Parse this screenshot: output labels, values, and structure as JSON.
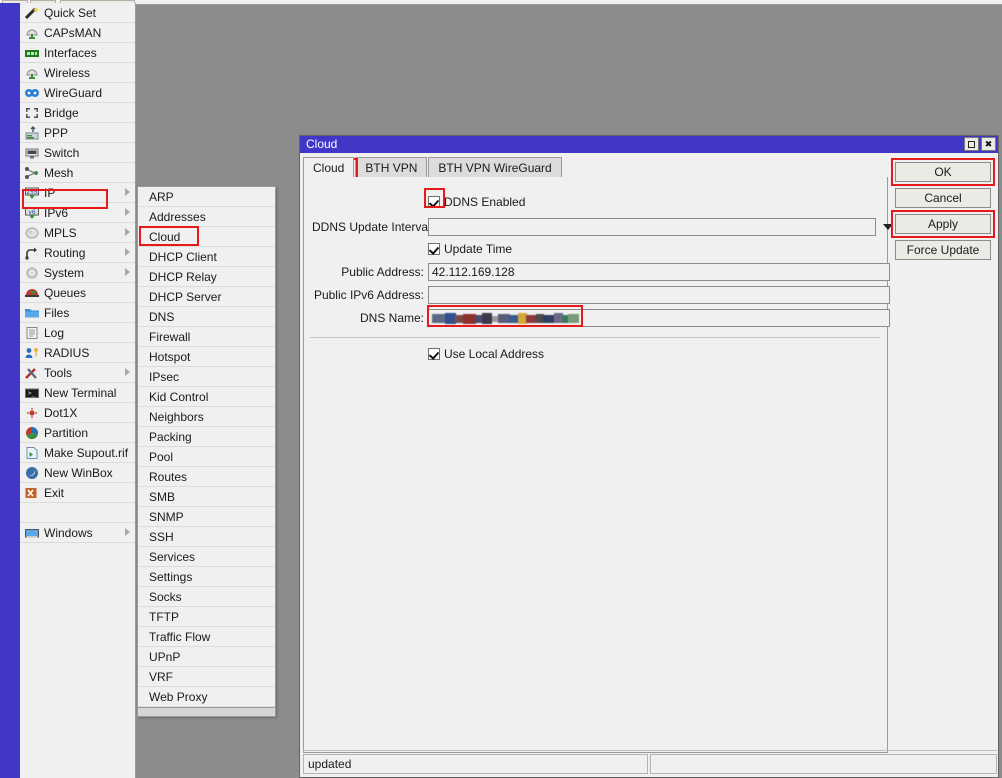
{
  "window": {
    "desktop_bg": "#8c8c8c",
    "accent": "#4036c8",
    "highlight_color": "#e51b1b"
  },
  "sidebar": {
    "items": [
      {
        "label": "Quick Set",
        "icon": "wand-icon",
        "submenu": false
      },
      {
        "label": "CAPsMAN",
        "icon": "antenna-icon",
        "submenu": false
      },
      {
        "label": "Interfaces",
        "icon": "network-card-icon",
        "submenu": false
      },
      {
        "label": "Wireless",
        "icon": "antenna-icon",
        "submenu": false
      },
      {
        "label": "WireGuard",
        "icon": "wireguard-icon",
        "submenu": false
      },
      {
        "label": "Bridge",
        "icon": "bridge-icon",
        "submenu": false
      },
      {
        "label": "PPP",
        "icon": "ppp-icon",
        "submenu": false
      },
      {
        "label": "Switch",
        "icon": "switch-icon",
        "submenu": false
      },
      {
        "label": "Mesh",
        "icon": "mesh-icon",
        "submenu": false
      },
      {
        "label": "IP",
        "icon": "ip-255-icon",
        "submenu": true
      },
      {
        "label": "IPv6",
        "icon": "ipv6-icon",
        "submenu": true
      },
      {
        "label": "MPLS",
        "icon": "mpls-icon",
        "submenu": true
      },
      {
        "label": "Routing",
        "icon": "routing-icon",
        "submenu": true
      },
      {
        "label": "System",
        "icon": "gear-icon",
        "submenu": true
      },
      {
        "label": "Queues",
        "icon": "queues-icon",
        "submenu": false
      },
      {
        "label": "Files",
        "icon": "folder-icon",
        "submenu": false
      },
      {
        "label": "Log",
        "icon": "log-icon",
        "submenu": false
      },
      {
        "label": "RADIUS",
        "icon": "radius-icon",
        "submenu": false
      },
      {
        "label": "Tools",
        "icon": "tools-icon",
        "submenu": true
      },
      {
        "label": "New Terminal",
        "icon": "terminal-icon",
        "submenu": false
      },
      {
        "label": "Dot1X",
        "icon": "dot1x-icon",
        "submenu": false
      },
      {
        "label": "Partition",
        "icon": "partition-icon",
        "submenu": false
      },
      {
        "label": "Make Supout.rif",
        "icon": "supout-icon",
        "submenu": false
      },
      {
        "label": "New WinBox",
        "icon": "winbox-icon",
        "submenu": false
      },
      {
        "label": "Exit",
        "icon": "exit-icon",
        "submenu": false
      },
      {
        "label": "",
        "icon": "",
        "submenu": false
      },
      {
        "label": "Windows",
        "icon": "windows-icon",
        "submenu": true
      }
    ],
    "selected": "IP"
  },
  "submenu": {
    "parent": "IP",
    "selected": "Cloud",
    "items": [
      "ARP",
      "Addresses",
      "Cloud",
      "DHCP Client",
      "DHCP Relay",
      "DHCP Server",
      "DNS",
      "Firewall",
      "Hotspot",
      "IPsec",
      "Kid Control",
      "Neighbors",
      "Packing",
      "Pool",
      "Routes",
      "SMB",
      "SNMP",
      "SSH",
      "Services",
      "Settings",
      "Socks",
      "TFTP",
      "Traffic Flow",
      "UPnP",
      "VRF",
      "Web Proxy"
    ]
  },
  "dialog": {
    "title": "Cloud",
    "window_buttons": {
      "restore": "restore-icon",
      "close": "✖"
    },
    "tabs": [
      {
        "label": "Cloud",
        "active": true
      },
      {
        "label": "BTH VPN",
        "active": false
      },
      {
        "label": "BTH VPN WireGuard",
        "active": false
      }
    ],
    "fields": {
      "ddns_enabled": {
        "label": "DDNS Enabled",
        "checked": true
      },
      "ddns_update_interval": {
        "label": "DDNS Update Interval:",
        "value": "",
        "placeholder": ""
      },
      "update_time": {
        "label": "Update Time",
        "checked": true
      },
      "public_address": {
        "label": "Public Address:",
        "value": "42.112.169.128"
      },
      "public_ipv6_address": {
        "label": "Public IPv6 Address:",
        "value": ""
      },
      "dns_name": {
        "label": "DNS Name:",
        "value": "",
        "redacted": true
      },
      "use_local_address": {
        "label": "Use Local Address",
        "checked": true
      }
    },
    "buttons": [
      {
        "label": "OK",
        "highlighted": true
      },
      {
        "label": "Cancel",
        "highlighted": false
      },
      {
        "label": "Apply",
        "highlighted": true
      },
      {
        "label": "Force Update",
        "highlighted": false
      }
    ],
    "statusbar": {
      "left": "updated",
      "right": ""
    }
  }
}
